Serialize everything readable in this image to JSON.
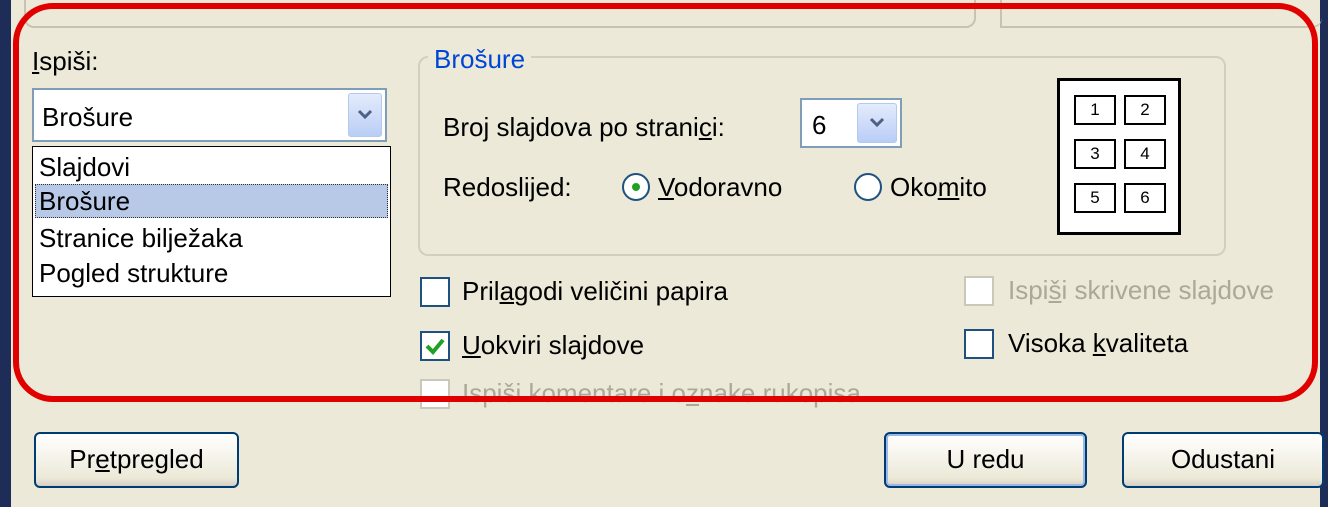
{
  "print_what": {
    "label_u": "I",
    "label_rest": "spiši:",
    "selected": "Brošure",
    "options": [
      "Slajdovi",
      "Brošure",
      "Stranice bilježaka",
      "Pogled strukture"
    ]
  },
  "handouts": {
    "title": "Brošure",
    "slides_per_page_a": "Broj slajdova po strani",
    "slides_per_page_u": "c",
    "slides_per_page_b": "i:",
    "slides_per_page_value": "6",
    "order_label": "Redoslijed:",
    "horizontal_u": "V",
    "horizontal_rest": "odoravno",
    "vertical_a": "Oko",
    "vertical_u": "m",
    "vertical_b": "ito",
    "order_selected": "horizontal",
    "preview_numbers": [
      "1",
      "2",
      "3",
      "4",
      "5",
      "6"
    ]
  },
  "options": {
    "scale_a": "Pril",
    "scale_u": "a",
    "scale_b": "godi veličini papira",
    "scale_checked": false,
    "frame_u": "U",
    "frame_rest": "okviri slajdove",
    "frame_checked": true,
    "comments_a": "Ispiši komentare i o",
    "comments_u": "z",
    "comments_b": "nake rukopisa",
    "comments_enabled": false,
    "hidden_a": "Ispi",
    "hidden_u": "š",
    "hidden_b": "i skrivene slajdove",
    "hidden_enabled": false,
    "quality_a": "Visoka ",
    "quality_u": "k",
    "quality_b": "valiteta",
    "quality_checked": false
  },
  "buttons": {
    "preview_a": "Pr",
    "preview_u": "e",
    "preview_b": "tpregled",
    "ok": "U redu",
    "cancel": "Odustani"
  },
  "colors": {
    "highlight_outline": "#e00000",
    "group_title": "#0046d5",
    "dialog_bg": "#ece9d8",
    "frame": "#1e2d57"
  }
}
